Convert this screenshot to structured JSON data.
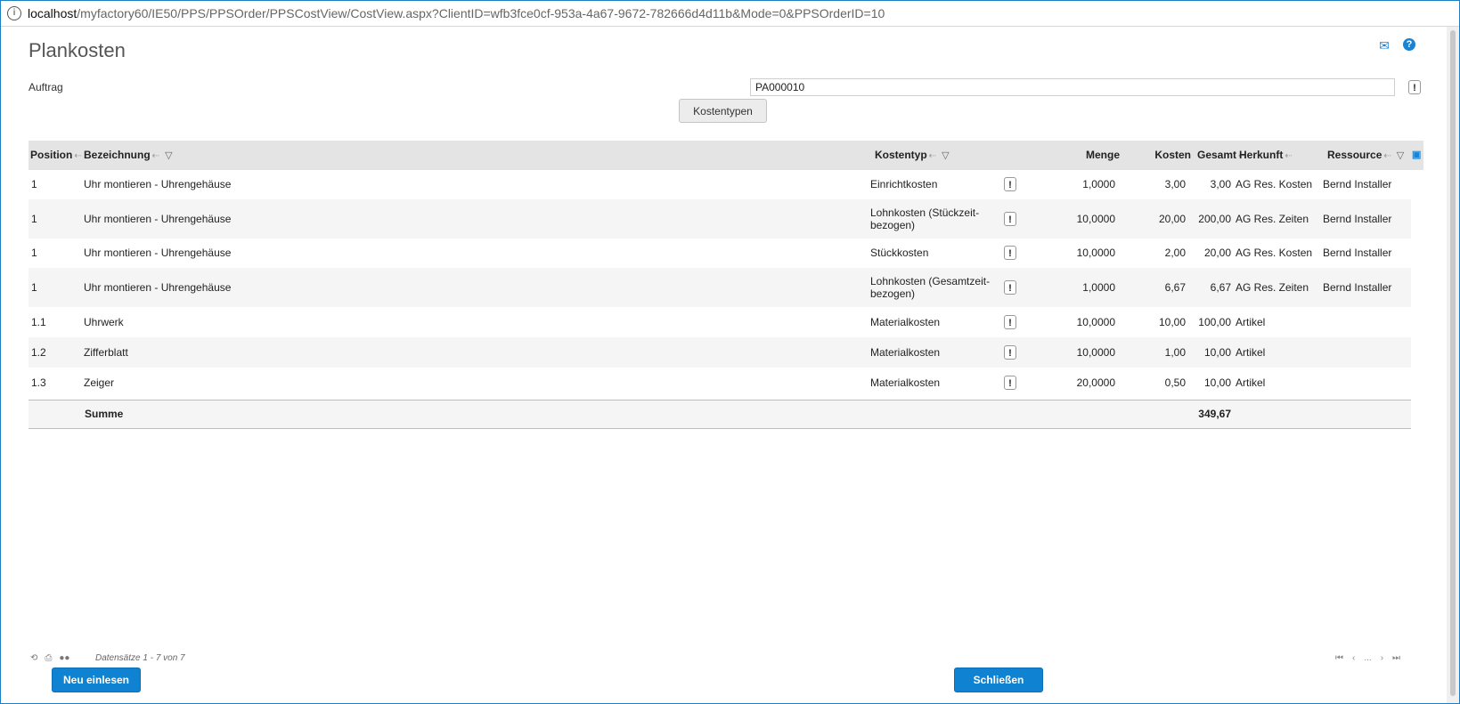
{
  "browser": {
    "url_host": "localhost",
    "url_path": "/myfactory60/IE50/PPS/PPSOrder/PPSCostView/CostView.aspx?ClientID=wfb3fce0cf-953a-4a67-9672-782666d4d11b&Mode=0&PPSOrderID=10"
  },
  "page": {
    "title": "Plankosten",
    "auftrag_label": "Auftrag",
    "auftrag_value": "PA000010",
    "kostentypen_label": "Kostentypen",
    "excl": "!"
  },
  "icons": {
    "mail": "envelope-icon",
    "help": "help-icon",
    "info": "info-icon"
  },
  "grid": {
    "headers": {
      "position": "Position",
      "bezeichnung": "Bezeichnung",
      "kostentyp": "Kostentyp",
      "menge": "Menge",
      "kosten": "Kosten",
      "gesamt": "Gesamt",
      "herkunft": "Herkunft",
      "ressource": "Ressource"
    },
    "rows": [
      {
        "position": "1",
        "bezeichnung": "Uhr montieren - Uhrengehäuse",
        "kostentyp": "Einrichtkosten",
        "menge": "1,0000",
        "kosten": "3,00",
        "gesamt": "3,00",
        "herkunft": "AG Res. Kosten",
        "ressource": "Bernd Installer"
      },
      {
        "position": "1",
        "bezeichnung": "Uhr montieren - Uhrengehäuse",
        "kostentyp": "Lohnkosten (Stückzeit-bezogen)",
        "menge": "10,0000",
        "kosten": "20,00",
        "gesamt": "200,00",
        "herkunft": "AG Res. Zeiten",
        "ressource": "Bernd Installer"
      },
      {
        "position": "1",
        "bezeichnung": "Uhr montieren - Uhrengehäuse",
        "kostentyp": "Stückkosten",
        "menge": "10,0000",
        "kosten": "2,00",
        "gesamt": "20,00",
        "herkunft": "AG Res. Kosten",
        "ressource": "Bernd Installer"
      },
      {
        "position": "1",
        "bezeichnung": "Uhr montieren - Uhrengehäuse",
        "kostentyp": "Lohnkosten (Gesamtzeit-bezogen)",
        "menge": "1,0000",
        "kosten": "6,67",
        "gesamt": "6,67",
        "herkunft": "AG Res. Zeiten",
        "ressource": "Bernd Installer"
      },
      {
        "position": "1.1",
        "bezeichnung": "Uhrwerk",
        "kostentyp": "Materialkosten",
        "menge": "10,0000",
        "kosten": "10,00",
        "gesamt": "100,00",
        "herkunft": "Artikel",
        "ressource": ""
      },
      {
        "position": "1.2",
        "bezeichnung": "Zifferblatt",
        "kostentyp": "Materialkosten",
        "menge": "10,0000",
        "kosten": "1,00",
        "gesamt": "10,00",
        "herkunft": "Artikel",
        "ressource": ""
      },
      {
        "position": "1.3",
        "bezeichnung": "Zeiger",
        "kostentyp": "Materialkosten",
        "menge": "20,0000",
        "kosten": "0,50",
        "gesamt": "10,00",
        "herkunft": "Artikel",
        "ressource": ""
      }
    ],
    "sum_label": "Summe",
    "sum_value": "349,67"
  },
  "footer": {
    "records": "Datensätze 1 - 7 von 7",
    "pager_ellipsis": "...",
    "neu_einlesen": "Neu einlesen",
    "schliessen": "Schließen"
  }
}
